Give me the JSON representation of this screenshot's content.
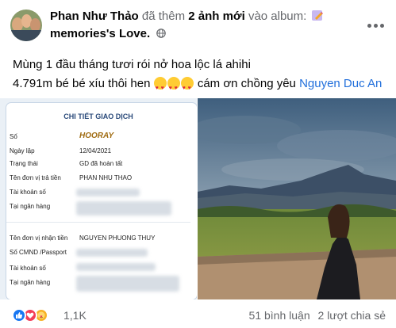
{
  "post": {
    "author": "Phan Như Thảo",
    "action_prefix": "đã thêm",
    "action_count": "2 ảnh mới",
    "action_suffix": "vào album:",
    "album": "memories's Love.",
    "caption_line1": "Mùng 1 đầu tháng tươi rói nở hoa lộc lá ahihi",
    "caption_line2_start": "4.791m bé bé xíu thôi hen",
    "caption_line2_mid": "cám ơn chồng yêu",
    "mention": "Nguyen Duc An",
    "icons": {
      "album": "pencil-icon",
      "privacy": "globe-icon",
      "menu": "more-options-icon"
    }
  },
  "receipt": {
    "title": "CHI TIẾT GIAO DỊCH",
    "stamp": "HOORAY",
    "rows": [
      {
        "label": "Số",
        "value": ""
      },
      {
        "label": "Ngày lập",
        "value": "12/04/2021"
      },
      {
        "label": "Trạng thái",
        "value": "GD đã hoàn tất"
      },
      {
        "label": "Tên đơn vị trả tiền",
        "value": "PHAN NHU THAO"
      },
      {
        "label": "Tài khoản số",
        "value": ""
      },
      {
        "label": "Tại ngân hàng",
        "value": ""
      },
      {
        "label": "Tên đơn vị nhận tiền",
        "value": "NGUYEN PHUONG THUY"
      },
      {
        "label": "Số CMND /Passport",
        "value": ""
      },
      {
        "label": "Tài khoản số",
        "value": ""
      },
      {
        "label": "Tại ngân hàng",
        "value": ""
      }
    ]
  },
  "stats": {
    "reactions": [
      "like",
      "love",
      "care"
    ],
    "reaction_count": "1,1K",
    "comments": "51 bình luận",
    "shares": "2 lượt chia sẻ"
  },
  "colors": {
    "mention": "#216fdb",
    "muted": "#65676b",
    "like": "#1877f2",
    "love": "#f33e58",
    "care": "#f7b125"
  }
}
